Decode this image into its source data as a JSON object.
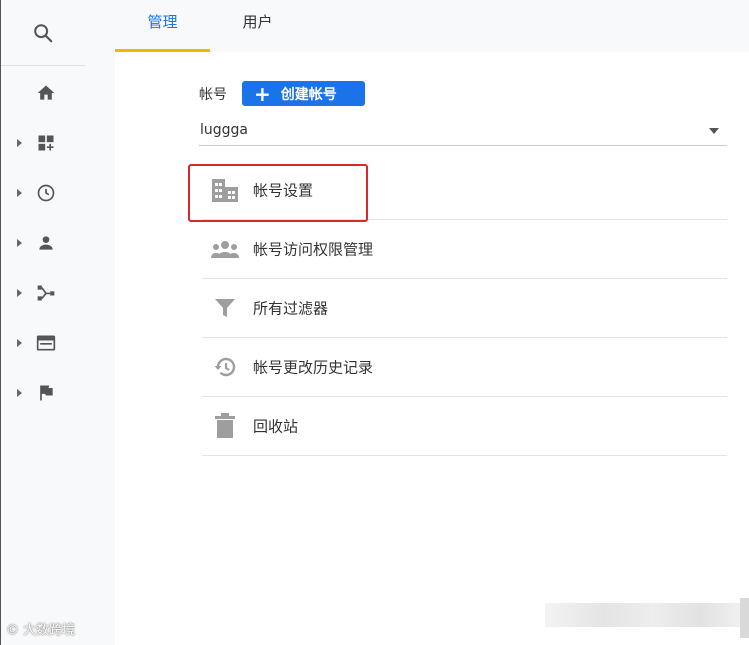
{
  "sidebar": {
    "search_icon": "search-icon",
    "items": [
      {
        "icon": "home-icon",
        "has_caret": false
      },
      {
        "icon": "dashboard-add-icon",
        "has_caret": true
      },
      {
        "icon": "clock-icon",
        "has_caret": true
      },
      {
        "icon": "person-icon",
        "has_caret": true
      },
      {
        "icon": "flow-icon",
        "has_caret": true
      },
      {
        "icon": "display-icon",
        "has_caret": true
      },
      {
        "icon": "flag-icon",
        "has_caret": true
      }
    ]
  },
  "tabs": [
    {
      "label": "管理",
      "active": true
    },
    {
      "label": "用户",
      "active": false
    }
  ],
  "account": {
    "label": "帐号",
    "create_button": "创建帐号",
    "selected": "luggga"
  },
  "menu": [
    {
      "label": "帐号设置",
      "icon": "building-icon"
    },
    {
      "label": "帐号访问权限管理",
      "icon": "people-icon"
    },
    {
      "label": "所有过滤器",
      "icon": "filter-icon"
    },
    {
      "label": "帐号更改历史记录",
      "icon": "history-icon"
    },
    {
      "label": "回收站",
      "icon": "trash-icon"
    }
  ],
  "colors": {
    "accent": "#1a73e8",
    "tab_underline": "#f4b400",
    "highlight_border": "#d9272b"
  },
  "watermark": "大数跨境"
}
